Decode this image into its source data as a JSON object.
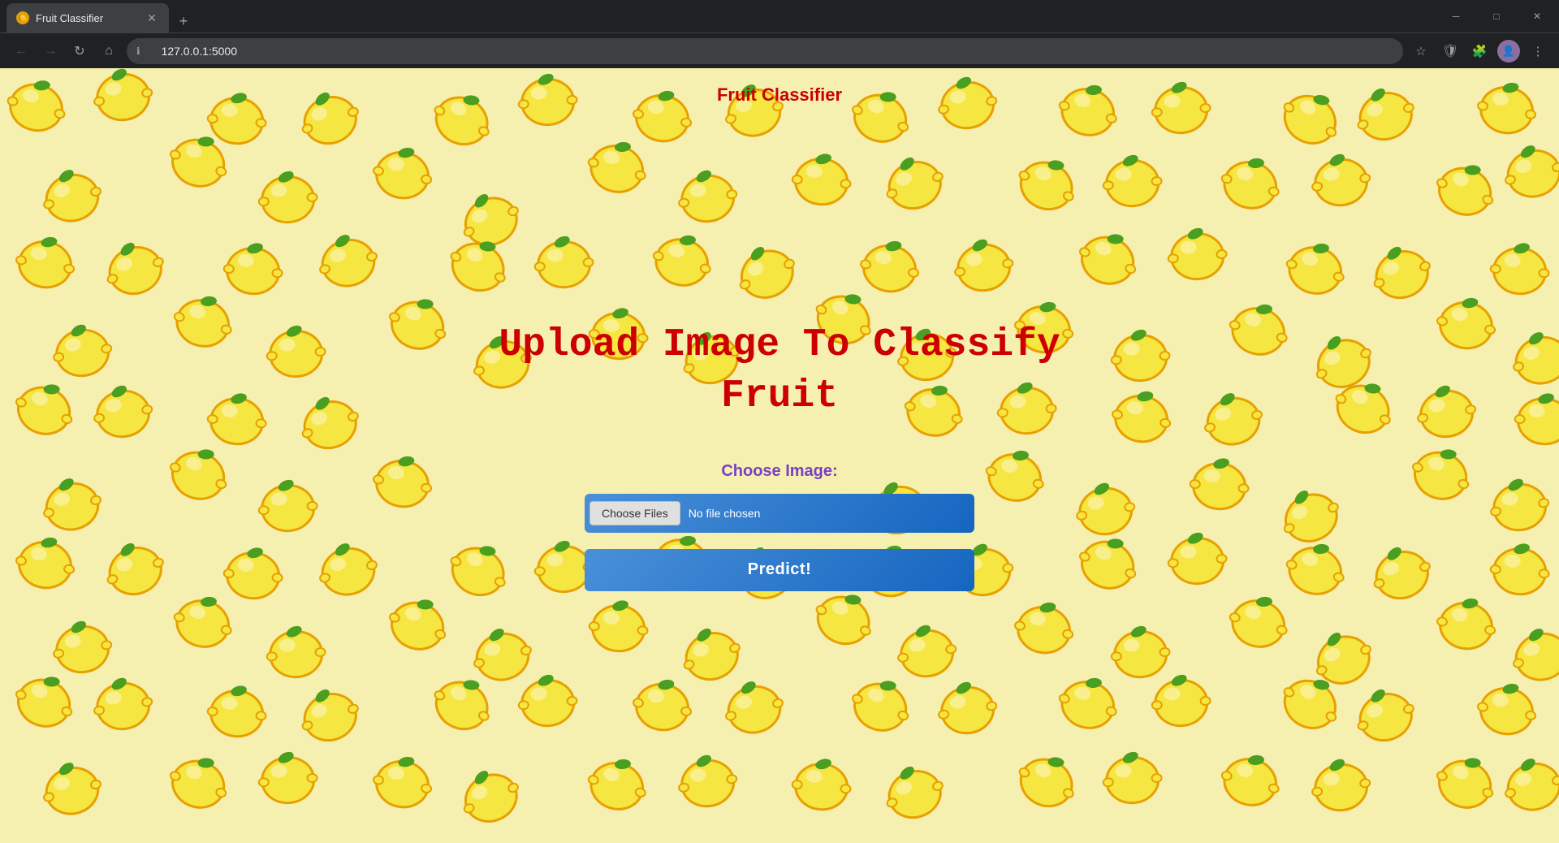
{
  "browser": {
    "tab_title": "Fruit Classifier",
    "url": "127.0.0.1:5000",
    "new_tab_label": "+",
    "close_label": "✕",
    "back_label": "←",
    "forward_label": "→",
    "refresh_label": "↻",
    "home_label": "⌂",
    "minimize_label": "─",
    "maximize_label": "□",
    "window_close_label": "✕",
    "bookmark_label": "☆",
    "extensions_label": "🧩",
    "menu_label": "⋮"
  },
  "page": {
    "title": "Fruit Classifier",
    "heading_line1": "Upload Image To Classify",
    "heading_line2": "Fruit",
    "choose_label": "Choose Image:",
    "file_btn_label": "Choose Files",
    "no_file_label": "No file chosen",
    "predict_btn_label": "Predict!"
  },
  "colors": {
    "heading_color": "#cc0000",
    "choose_label_color": "#7b3fc4",
    "btn_gradient_start": "#4a90d9",
    "btn_gradient_end": "#1565c0",
    "page_bg": "#f5f0b0"
  }
}
